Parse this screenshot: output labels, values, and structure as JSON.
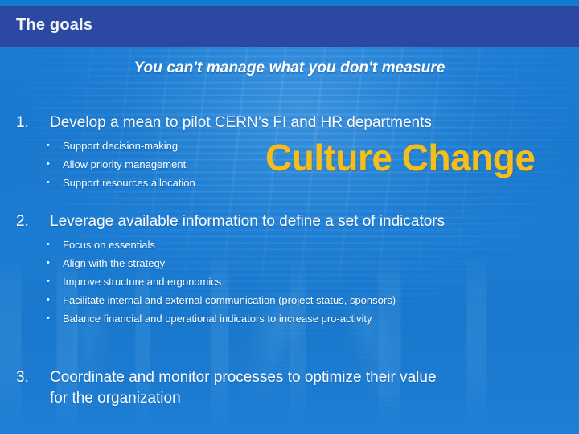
{
  "slide": {
    "title": "The goals",
    "subtitle": "You can't manage what you don't measure",
    "overlay_text": "Culture Change",
    "colors": {
      "title_bar": "#2b48a3",
      "background": "#1b7bd4",
      "top_strip": "#1479d1",
      "body_text": "#ffffff",
      "overlay_accent": "#f4bf1c"
    }
  },
  "goals": [
    {
      "number": "1.",
      "title": "Develop a mean to pilot CERN’s FI and HR departments",
      "title_lines": [
        "Develop a mean to pilot CERN’s FI and HR departments"
      ],
      "bullets": [
        "Support decision-making",
        "Allow priority management",
        "Support resources allocation"
      ]
    },
    {
      "number": "2.",
      "title": "Leverage available information to define a set of indicators",
      "title_lines": [
        "Leverage available information to define a set of indicators"
      ],
      "bullets": [
        "Focus on essentials",
        "Align with the strategy",
        "Improve structure and ergonomics",
        "Facilitate internal and external communication (project status, sponsors)",
        "Balance financial and operational indicators to increase pro-activity"
      ]
    },
    {
      "number": "3.",
      "title": "Coordinate and monitor processes to optimize their value for the organization",
      "title_lines": [
        "Coordinate and monitor processes to optimize their value",
        "for the organization"
      ],
      "bullets": []
    }
  ],
  "bullet_glyph": "•"
}
